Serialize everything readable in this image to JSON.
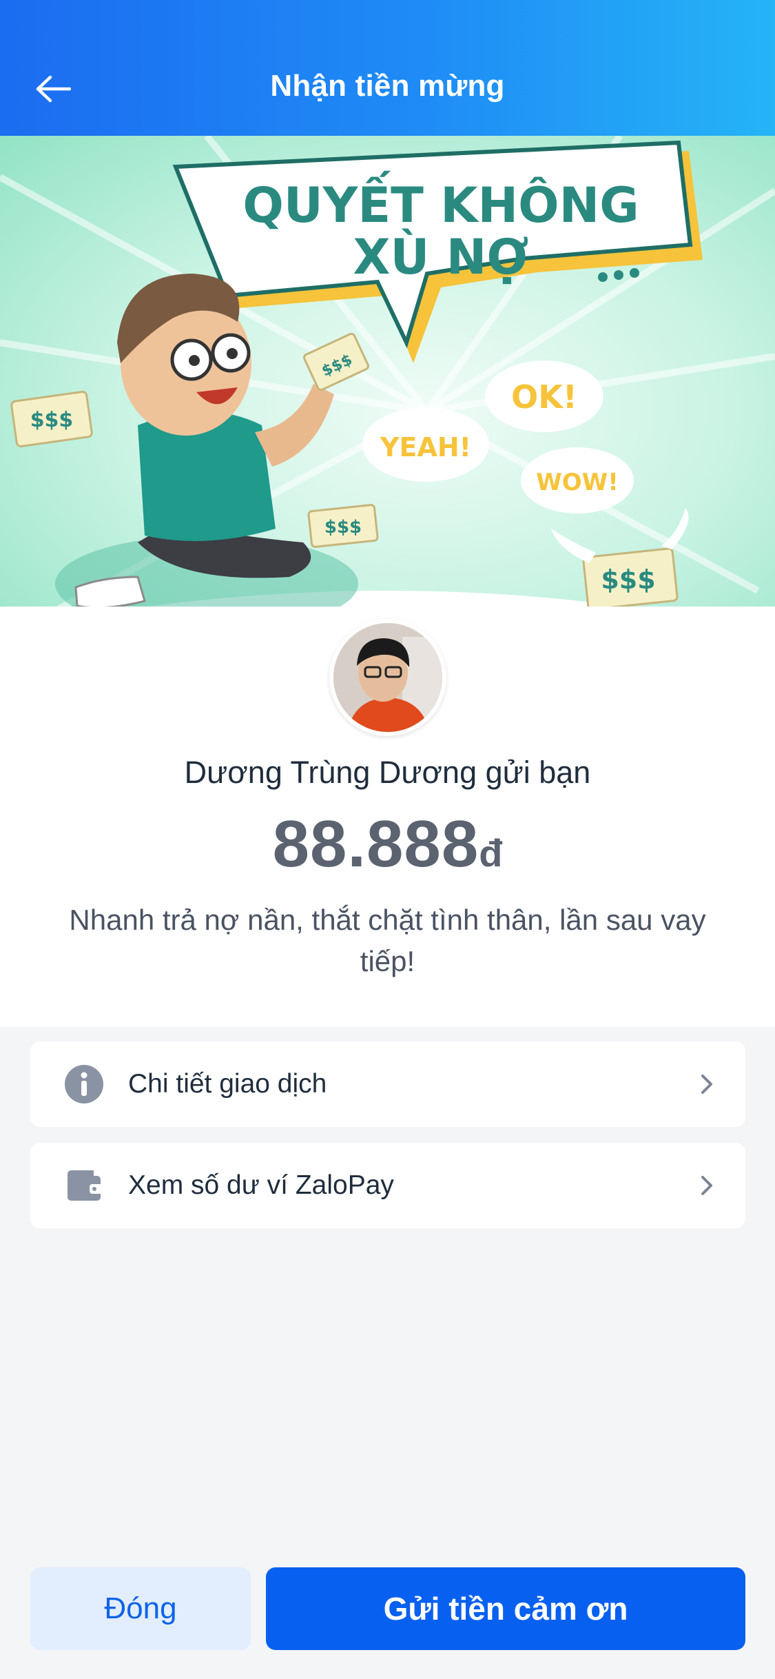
{
  "header": {
    "title": "Nhận tiền mừng",
    "back_icon": "arrow-left-icon"
  },
  "banner": {
    "headline_line1": "QUYẾT KHÔNG",
    "headline_line2": "XÙ NỢ",
    "bubble_ok": "OK!",
    "bubble_yeah": "YEAH!",
    "bubble_wow": "WOW!",
    "money_text": "$$$",
    "bg_color": "#bff1dd",
    "accent_color": "#f6c33a"
  },
  "gift": {
    "sender_line": "Dương Trùng Dương gửi bạn",
    "amount": "88.888",
    "currency": "đ",
    "message": "Nhanh trả nợ nần, thắt chặt tình thân, lần sau vay tiếp!"
  },
  "menu": {
    "items": [
      {
        "label": "Chi tiết giao dịch",
        "icon": "info-icon"
      },
      {
        "label": "Xem số dư ví ZaloPay",
        "icon": "wallet-icon"
      }
    ]
  },
  "actions": {
    "close_label": "Đóng",
    "send_label": "Gửi tiền cảm ơn"
  },
  "colors": {
    "primary": "#0860f0",
    "header_gradient_start": "#1b6cf0",
    "header_gradient_end": "#25b4f6",
    "page_bg": "#f4f5f7"
  }
}
